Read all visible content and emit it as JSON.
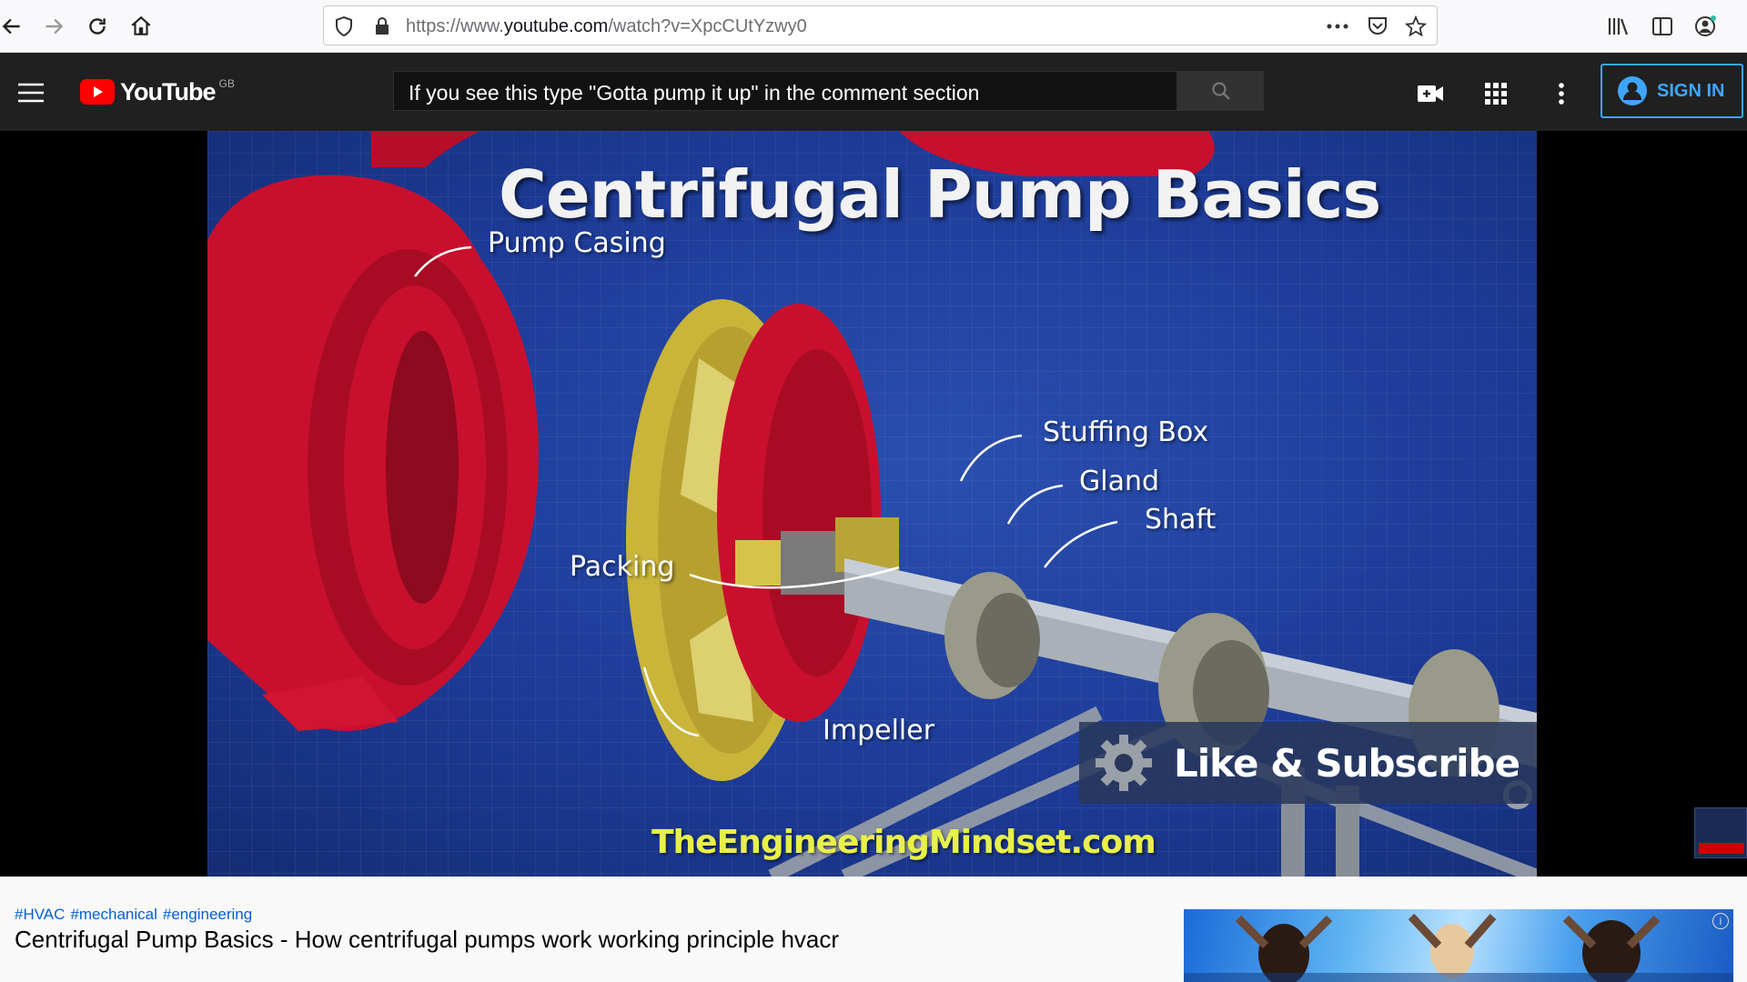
{
  "browser": {
    "url_prefix": "https://www.",
    "url_domain": "youtube.com",
    "url_path": "/watch?v=XpcCUtYzwy0"
  },
  "masthead": {
    "logo_text": "YouTube",
    "region": "GB",
    "search_query": "If you see this type \"Gotta pump it up\" in the comment section",
    "sign_in_label": "SIGN IN"
  },
  "video": {
    "title": "Centrifugal Pump Basics",
    "labels": {
      "pump_casing": "Pump Casing",
      "stuffing_box": "Stuffing Box",
      "gland": "Gland",
      "shaft": "Shaft",
      "packing": "Packing",
      "impeller": "Impeller"
    },
    "subscribe_text": "Like & Subscribe",
    "website": "TheEngineeringMindset.com"
  },
  "info": {
    "hashtags": [
      "#HVAC",
      "#mechanical",
      "#engineering"
    ],
    "title": "Centrifugal Pump Basics - How centrifugal pumps work working principle hvacr"
  },
  "colors": {
    "accent_blue": "#3ea6ff",
    "masthead_bg": "#202020",
    "youtube_red": "#ff0000",
    "site_yellow": "#e8f04a"
  }
}
